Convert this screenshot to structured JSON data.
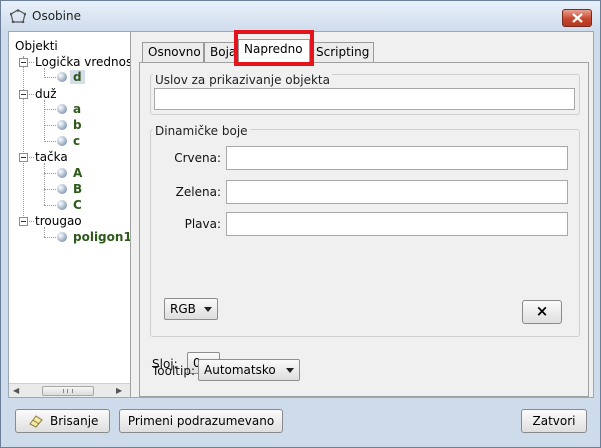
{
  "window": {
    "title": "Osobine"
  },
  "tree": {
    "root": "Objekti",
    "groups": [
      {
        "label": "Logička vrednost",
        "children": [
          {
            "label": "d",
            "selected": true
          }
        ]
      },
      {
        "label": "duž",
        "children": [
          {
            "label": "a"
          },
          {
            "label": "b"
          },
          {
            "label": "c"
          }
        ]
      },
      {
        "label": "tačka",
        "children": [
          {
            "label": "A"
          },
          {
            "label": "B"
          },
          {
            "label": "C"
          }
        ]
      },
      {
        "label": "trougao",
        "children": [
          {
            "label": "poligon1"
          }
        ]
      }
    ],
    "scroll_grip": "III"
  },
  "tabs": [
    {
      "label": "Osnovno"
    },
    {
      "label": "Boja"
    },
    {
      "label": "Napredno",
      "active": true
    },
    {
      "label": "Scripting"
    }
  ],
  "advanced": {
    "condition_title": "Uslov za prikazivanje objekta",
    "condition_value": "",
    "dynamic_colors_title": "Dinamičke boje",
    "red_label": "Crvena:",
    "red_value": "",
    "green_label": "Zelena:",
    "green_value": "",
    "blue_label": "Plava:",
    "blue_value": "",
    "color_mode": "RGB",
    "clear_label": "×",
    "layer_label": "Sloj:",
    "layer_value": "0",
    "tooltip_label": "Tooltip:",
    "tooltip_value": "Automatsko"
  },
  "footer": {
    "delete_label": "Brisanje",
    "defaults_label": "Primeni podrazumevano",
    "close_label": "Zatvori"
  },
  "colors": {
    "highlight": "#e3141c",
    "leaf_text": "#2d5a1b",
    "title_close": "#c7472f"
  }
}
